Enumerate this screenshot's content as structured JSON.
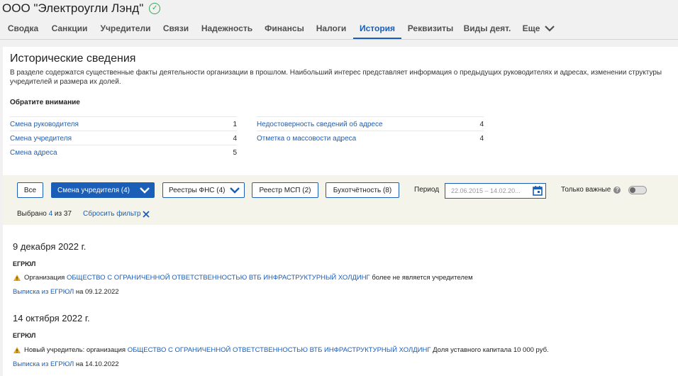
{
  "header": {
    "company": "ООО \"Электроугли Лэнд\""
  },
  "tabs": [
    {
      "label": "Сводка"
    },
    {
      "label": "Санкции"
    },
    {
      "label": "Учредители"
    },
    {
      "label": "Связи"
    },
    {
      "label": "Надежность"
    },
    {
      "label": "Финансы"
    },
    {
      "label": "Налоги"
    },
    {
      "label": "История",
      "active": true
    },
    {
      "label": "Реквизиты"
    },
    {
      "label": "Виды деят."
    },
    {
      "label": "Еще"
    }
  ],
  "history": {
    "title": "Исторические сведения",
    "description": "В разделе содержатся существенные факты деятельности организации в прошлом. Наибольший интерес представляет информация о предыдущих руководителях и адресах, изменении структуры учредителей и размера их долей.",
    "attention": "Обратите внимание",
    "stats_left": [
      {
        "label": "Смена руководителя",
        "count": "1"
      },
      {
        "label": "Смена учредителя",
        "count": "4"
      },
      {
        "label": "Смена адреса",
        "count": "5"
      }
    ],
    "stats_right": [
      {
        "label": "Недостоверность сведений об адресе",
        "count": "4"
      },
      {
        "label": "Отметка о массовости адреса",
        "count": "4"
      }
    ]
  },
  "filters": {
    "all": "Все",
    "founder_change": "Смена учредителя (4)",
    "fns": "Реестры ФНС (4)",
    "msp": "Реестр МСП (2)",
    "buh": "Бухотчётность (8)",
    "period_label": "Период",
    "period_value": "22.06.2015 – 14.02.20...",
    "important_only": "Только важные",
    "selected_prefix": "Выбрано",
    "selected_count": "4",
    "selected_suffix": "из 37",
    "reset": "Сбросить фильтр"
  },
  "events": [
    {
      "date": "9 декабря 2022 г.",
      "source": "ЕГРЮЛ",
      "text_before": "Организация",
      "org": "ОБЩЕСТВО С ОГРАНИЧЕННОЙ ОТВЕТСТВЕННОСТЬЮ ВТБ ИНФРАСТРУКТУРНЫЙ ХОЛДИНГ",
      "text_after": "более не является учредителем",
      "extract_link": "Выписка из ЕГРЮЛ",
      "extract_date": "на 09.12.2022"
    },
    {
      "date": "14 октября 2022 г.",
      "source": "ЕГРЮЛ",
      "text_before": "Новый учредитель: организация",
      "org": "ОБЩЕСТВО С ОГРАНИЧЕННОЙ ОТВЕТСТВЕННОСТЬЮ ВТБ ИНФРАСТРУКТУРНЫЙ ХОЛДИНГ",
      "text_after": "Доля уставного капитала 10 000 руб.",
      "extract_link": "Выписка из ЕГРЮЛ",
      "extract_date": "на 14.10.2022"
    }
  ],
  "colors": {
    "accent": "#1a5eb8",
    "warning": "#e6a817",
    "verified": "#3aa655",
    "filter_bg": "#f5f4ea"
  }
}
